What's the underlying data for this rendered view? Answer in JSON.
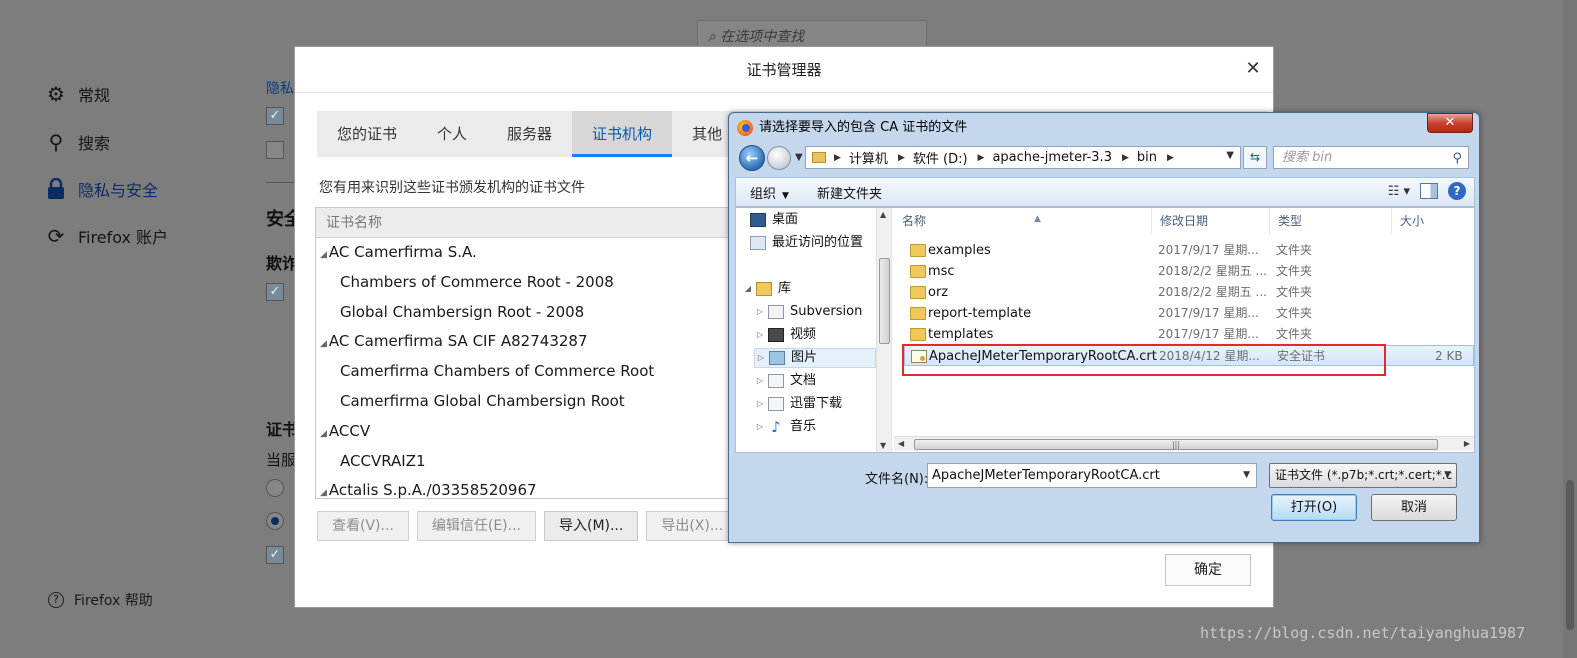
{
  "background": {
    "search_placeholder": "在选项中查找",
    "nav": [
      {
        "label": "常规",
        "icon": "gear-icon"
      },
      {
        "label": "搜索",
        "icon": "search-icon"
      },
      {
        "label": "隐私与安全",
        "icon": "lock-icon"
      },
      {
        "label": "Firefox 账户",
        "icon": "sync-icon"
      }
    ],
    "help_label": "Firefox 帮助",
    "privacy_link": "隐私",
    "partial_texts": [
      "安全",
      "欺诈",
      "证书",
      "当服"
    ]
  },
  "cert_manager": {
    "title": "证书管理器",
    "tabs": [
      "您的证书",
      "个人",
      "服务器",
      "证书机构",
      "其他"
    ],
    "active_tab": "证书机构",
    "description": "您有用来识别这些证书颁发机构的证书文件",
    "column_header": "证书名称",
    "rows": [
      {
        "label": "AC Camerfirma S.A.",
        "group": true
      },
      {
        "label": "Chambers of Commerce Root - 2008",
        "group": false
      },
      {
        "label": "Global Chambersign Root - 2008",
        "group": false
      },
      {
        "label": "AC Camerfirma SA CIF A82743287",
        "group": true
      },
      {
        "label": "Camerfirma Chambers of Commerce Root",
        "group": false
      },
      {
        "label": "Camerfirma Global Chambersign Root",
        "group": false
      },
      {
        "label": "ACCV",
        "group": true
      },
      {
        "label": "ACCVRAIZ1",
        "group": false
      },
      {
        "label": "Actalis S.p.A./03358520967",
        "group": true
      }
    ],
    "buttons": {
      "view": "查看(V)...",
      "edit_trust": "编辑信任(E)...",
      "import": "导入(M)...",
      "export": "导出(X)..."
    },
    "ok": "确定"
  },
  "file_dialog": {
    "title": "请选择要导入的包含 CA 证书的文件",
    "breadcrumb": [
      "计算机",
      "软件 (D:)",
      "apache-jmeter-3.3",
      "bin"
    ],
    "search_placeholder": "搜索 bin",
    "toolbar": {
      "organize": "组织",
      "new_folder": "新建文件夹"
    },
    "tree": [
      {
        "label": "桌面",
        "icon": "desktop-icon"
      },
      {
        "label": "最近访问的位置",
        "icon": "recent-places-icon"
      },
      {
        "label": "库",
        "icon": "library-icon"
      },
      {
        "label": "Subversion",
        "icon": "document-library-icon"
      },
      {
        "label": "视频",
        "icon": "video-library-icon"
      },
      {
        "label": "图片",
        "icon": "picture-library-icon"
      },
      {
        "label": "文档",
        "icon": "document-library-icon"
      },
      {
        "label": "迅雷下载",
        "icon": "document-library-icon"
      },
      {
        "label": "音乐",
        "icon": "music-library-icon"
      }
    ],
    "columns": {
      "name": "名称",
      "date": "修改日期",
      "type": "类型",
      "size": "大小"
    },
    "files": [
      {
        "name": "examples",
        "date": "2017/9/17 星期...",
        "type": "文件夹",
        "size": ""
      },
      {
        "name": "msc",
        "date": "2018/2/2 星期五 ...",
        "type": "文件夹",
        "size": ""
      },
      {
        "name": "orz",
        "date": "2018/2/2 星期五 ...",
        "type": "文件夹",
        "size": ""
      },
      {
        "name": "report-template",
        "date": "2017/9/17 星期...",
        "type": "文件夹",
        "size": ""
      },
      {
        "name": "templates",
        "date": "2017/9/17 星期...",
        "type": "文件夹",
        "size": ""
      },
      {
        "name": "ApacheJMeterTemporaryRootCA.crt",
        "date": "2018/4/12 星期...",
        "type": "安全证书",
        "size": "2 KB"
      }
    ],
    "filename_label": "文件名(N):",
    "filename_value": "ApacheJMeterTemporaryRootCA.crt",
    "filetype_value": "证书文件 (*.p7b;*.crt;*.cert;*.c",
    "open": "打开(O)",
    "cancel": "取消",
    "highlight_color": "#e8272b"
  },
  "watermark": "https://blog.csdn.net/taiyanghua1987"
}
